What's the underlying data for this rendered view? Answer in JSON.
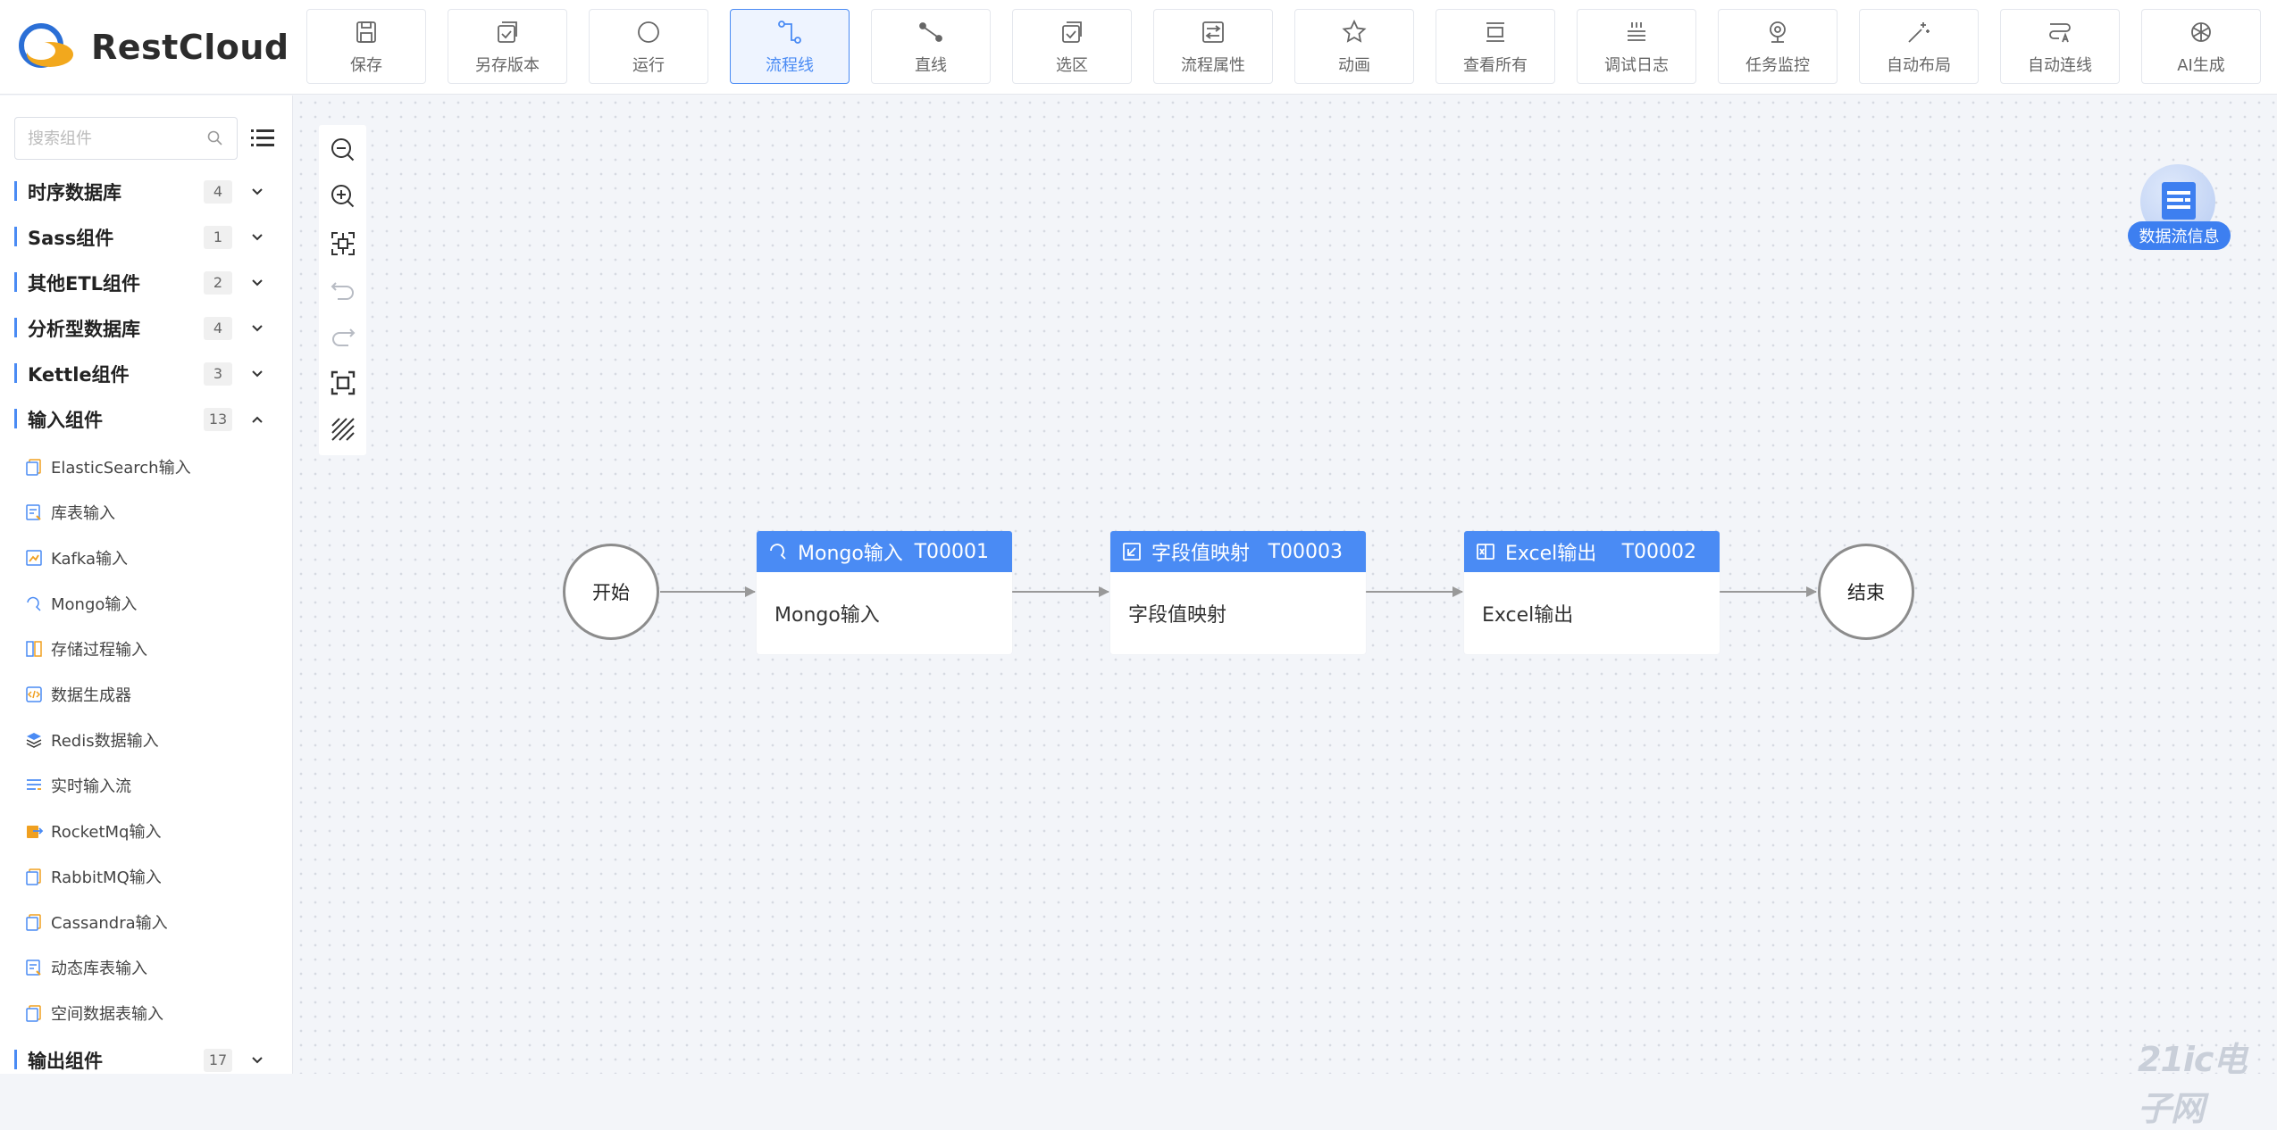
{
  "app": {
    "brand": "RestCloud"
  },
  "toolbar": {
    "buttons": [
      {
        "label": "保存",
        "icon": "save-icon"
      },
      {
        "label": "另存版本",
        "icon": "save-version-icon"
      },
      {
        "label": "运行",
        "icon": "run-icon"
      },
      {
        "label": "流程线",
        "icon": "flow-line-icon",
        "active": true
      },
      {
        "label": "直线",
        "icon": "straight-line-icon"
      },
      {
        "label": "选区",
        "icon": "selection-icon"
      },
      {
        "label": "流程属性",
        "icon": "flow-properties-icon"
      },
      {
        "label": "动画",
        "icon": "animation-icon"
      },
      {
        "label": "查看所有",
        "icon": "view-all-icon"
      },
      {
        "label": "调试日志",
        "icon": "debug-log-icon"
      },
      {
        "label": "任务监控",
        "icon": "task-monitor-icon"
      },
      {
        "label": "自动布局",
        "icon": "auto-layout-icon"
      },
      {
        "label": "自动连线",
        "icon": "auto-connect-icon"
      },
      {
        "label": "AI生成",
        "icon": "ai-generate-icon"
      }
    ]
  },
  "sidebar": {
    "search_placeholder": "搜索组件",
    "categories": [
      {
        "name": "时序数据库",
        "count": "4",
        "expanded": false
      },
      {
        "name": "Sass组件",
        "count": "1",
        "expanded": false
      },
      {
        "name": "其他ETL组件",
        "count": "2",
        "expanded": false
      },
      {
        "name": "分析型数据库",
        "count": "4",
        "expanded": false
      },
      {
        "name": "Kettle组件",
        "count": "3",
        "expanded": false
      },
      {
        "name": "输入组件",
        "count": "13",
        "expanded": true
      },
      {
        "name": "输出组件",
        "count": "17",
        "expanded": false
      }
    ],
    "input_items": [
      {
        "label": "ElasticSearch输入",
        "icon": "document-icon"
      },
      {
        "label": "库表输入",
        "icon": "table-input-icon"
      },
      {
        "label": "Kafka输入",
        "icon": "kafka-icon"
      },
      {
        "label": "Mongo输入",
        "icon": "mongo-icon"
      },
      {
        "label": "存储过程输入",
        "icon": "procedure-icon"
      },
      {
        "label": "数据生成器",
        "icon": "code-generator-icon"
      },
      {
        "label": "Redis数据输入",
        "icon": "redis-icon"
      },
      {
        "label": "实时输入流",
        "icon": "stream-icon"
      },
      {
        "label": "RocketMq输入",
        "icon": "rocketmq-icon"
      },
      {
        "label": "RabbitMQ输入",
        "icon": "document-icon"
      },
      {
        "label": "Cassandra输入",
        "icon": "document-icon"
      },
      {
        "label": "动态库表输入",
        "icon": "table-input-icon"
      },
      {
        "label": "空间数据表输入",
        "icon": "document-icon"
      }
    ]
  },
  "canvas": {
    "info_badge": "数据流信息",
    "start_label": "开始",
    "end_label": "结束",
    "nodes": [
      {
        "title": "Mongo输入",
        "code": "T00001",
        "body": "Mongo输入",
        "icon": "mongo-icon"
      },
      {
        "title": "字段值映射",
        "code": "T00003",
        "body": "字段值映射",
        "icon": "mapping-icon"
      },
      {
        "title": "Excel输出",
        "code": "T00002",
        "body": "Excel输出",
        "icon": "excel-icon"
      }
    ]
  },
  "watermark": "21ic电子网",
  "colors": {
    "accent": "#4a8bf4",
    "node_header": "#4a8bf4",
    "badge": "#3d7ff0"
  }
}
